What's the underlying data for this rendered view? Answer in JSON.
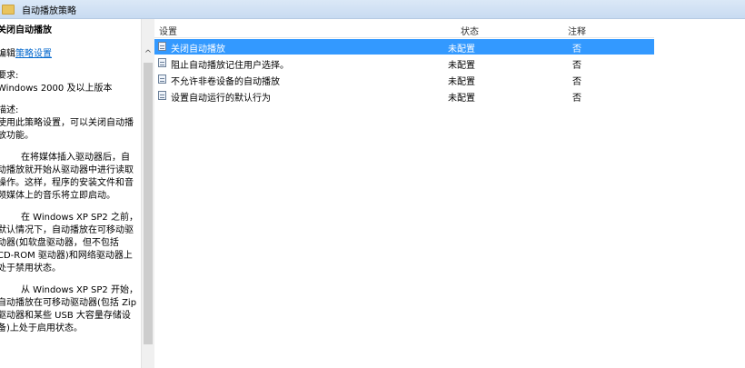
{
  "window": {
    "title": "自动播放策略"
  },
  "description": {
    "heading": "关闭自动播放",
    "edit_prefix": "编辑",
    "edit_link": "策略设置",
    "requirements_label": "要求:",
    "requirements_value": "Windows 2000 及以上版本",
    "description_label": "描述:",
    "para1": "使用此策略设置，可以关闭自动播放功能。",
    "para2": "在将媒体插入驱动器后，自动播放就开始从驱动器中进行读取操作。这样，程序的安装文件和音频媒体上的音乐将立即启动。",
    "para3": "在 Windows XP SP2 之前，默认情况下，自动播放在可移动驱动器(如软盘驱动器，但不包括 CD-ROM 驱动器)和网络驱动器上处于禁用状态。",
    "para4": "从 Windows XP SP2 开始，自动播放在可移动驱动器(包括 Zip 驱动器和某些 USB 大容量存储设备)上处于启用状态。"
  },
  "table": {
    "headers": {
      "setting": "设置",
      "state": "状态",
      "note": "注释"
    },
    "rows": [
      {
        "name": "关闭自动播放",
        "state": "未配置",
        "note": "否",
        "selected": true
      },
      {
        "name": "阻止自动播放记住用户选择。",
        "state": "未配置",
        "note": "否",
        "selected": false
      },
      {
        "name": "不允许非卷设备的自动播放",
        "state": "未配置",
        "note": "否",
        "selected": false
      },
      {
        "name": "设置自动运行的默认行为",
        "state": "未配置",
        "note": "否",
        "selected": false
      }
    ]
  },
  "colors": {
    "selection": "#3399ff",
    "link": "#0066cc"
  }
}
